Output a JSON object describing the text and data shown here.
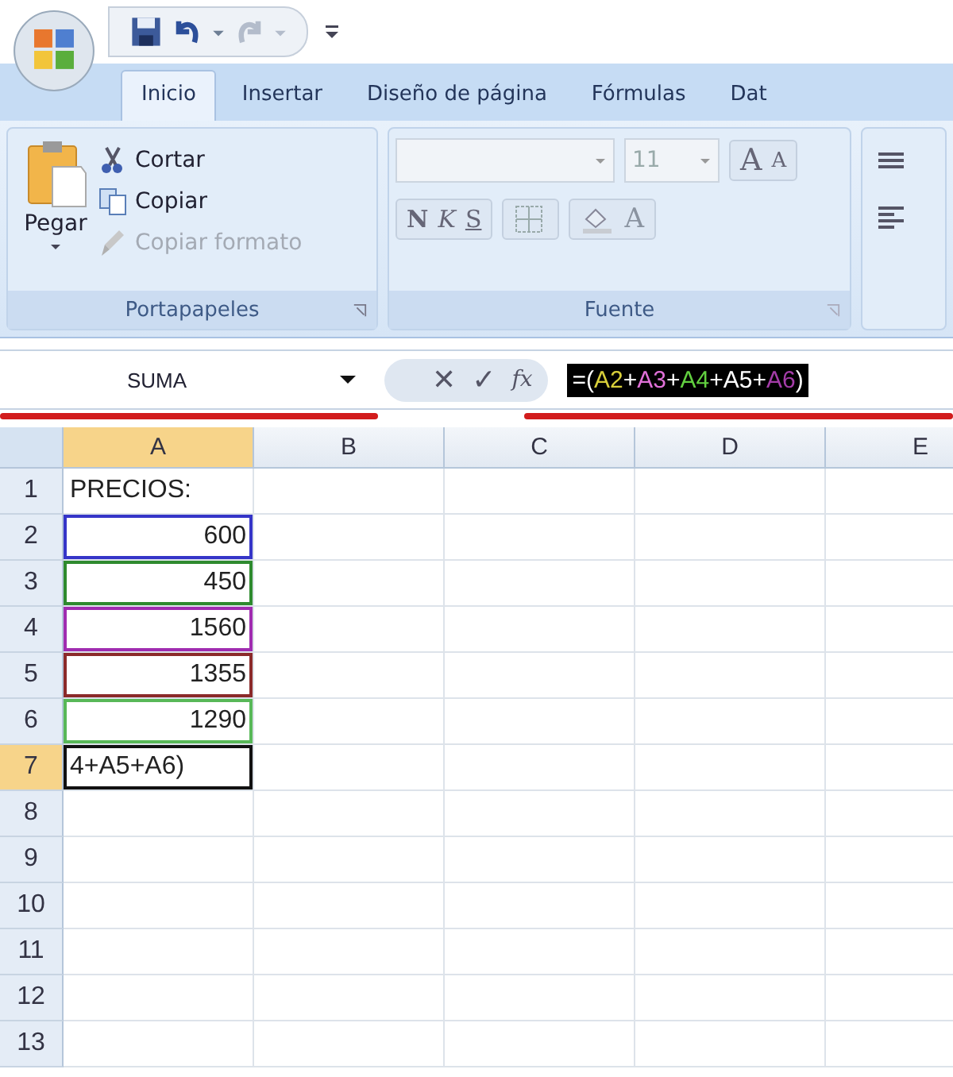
{
  "tabs": [
    {
      "label": "Inicio",
      "selected": true
    },
    {
      "label": "Insertar",
      "selected": false
    },
    {
      "label": "Diseño de página",
      "selected": false
    },
    {
      "label": "Fórmulas",
      "selected": false
    },
    {
      "label": "Dat",
      "selected": false
    }
  ],
  "clipboard": {
    "title": "Portapapeles",
    "paste": "Pegar",
    "items": [
      {
        "label": "Cortar",
        "disabled": false
      },
      {
        "label": "Copiar",
        "disabled": false
      },
      {
        "label": "Copiar formato",
        "disabled": true
      }
    ]
  },
  "font": {
    "title": "Fuente",
    "size": "11",
    "grow": "A",
    "shrink": "A",
    "bold": "N",
    "italic": "K",
    "underline": "S",
    "text_color_letter": "A"
  },
  "name_box": "SUMA",
  "formula_buttons": [
    "✕",
    "✓",
    "fx"
  ],
  "formula": [
    {
      "text": "=(",
      "color": "#ffffff"
    },
    {
      "text": "A2",
      "color": "#d8cf3a"
    },
    {
      "text": "+",
      "color": "#ffffff"
    },
    {
      "text": "A3",
      "color": "#e070d8"
    },
    {
      "text": "+",
      "color": "#ffffff"
    },
    {
      "text": "A4",
      "color": "#62d040"
    },
    {
      "text": "+A5+",
      "color": "#ffffff"
    },
    {
      "text": "A6",
      "color": "#a43ca8"
    },
    {
      "text": ")",
      "color": "#ffffff"
    }
  ],
  "columns": [
    {
      "label": "A",
      "selected": true
    },
    {
      "label": "B",
      "selected": false
    },
    {
      "label": "C",
      "selected": false
    },
    {
      "label": "D",
      "selected": false
    },
    {
      "label": "E",
      "selected": false
    }
  ],
  "rows": [
    {
      "label": "1",
      "selected": false,
      "cells": [
        {
          "kind": "text",
          "text": "PRECIOS:"
        }
      ]
    },
    {
      "label": "2",
      "selected": false,
      "cells": [
        {
          "kind": "number",
          "text": "600",
          "color": "#3535c8"
        }
      ]
    },
    {
      "label": "3",
      "selected": false,
      "cells": [
        {
          "kind": "number",
          "text": "450",
          "color": "#2e8a2e"
        }
      ]
    },
    {
      "label": "4",
      "selected": false,
      "cells": [
        {
          "kind": "number",
          "text": "1560",
          "color": "#a02cb0"
        }
      ]
    },
    {
      "label": "5",
      "selected": false,
      "cells": [
        {
          "kind": "number",
          "text": "1355",
          "color": "#8b2a2a"
        }
      ]
    },
    {
      "label": "6",
      "selected": false,
      "cells": [
        {
          "kind": "number",
          "text": "1290",
          "color": "#58b858"
        }
      ]
    },
    {
      "label": "7",
      "selected": true,
      "cells": [
        {
          "kind": "editing",
          "text": "4+A5+A6)"
        }
      ]
    },
    {
      "label": "8",
      "selected": false,
      "cells": []
    },
    {
      "label": "9",
      "selected": false,
      "cells": []
    },
    {
      "label": "10",
      "selected": false,
      "cells": []
    },
    {
      "label": "11",
      "selected": false,
      "cells": []
    },
    {
      "label": "12",
      "selected": false,
      "cells": []
    },
    {
      "label": "13",
      "selected": false,
      "cells": []
    }
  ]
}
